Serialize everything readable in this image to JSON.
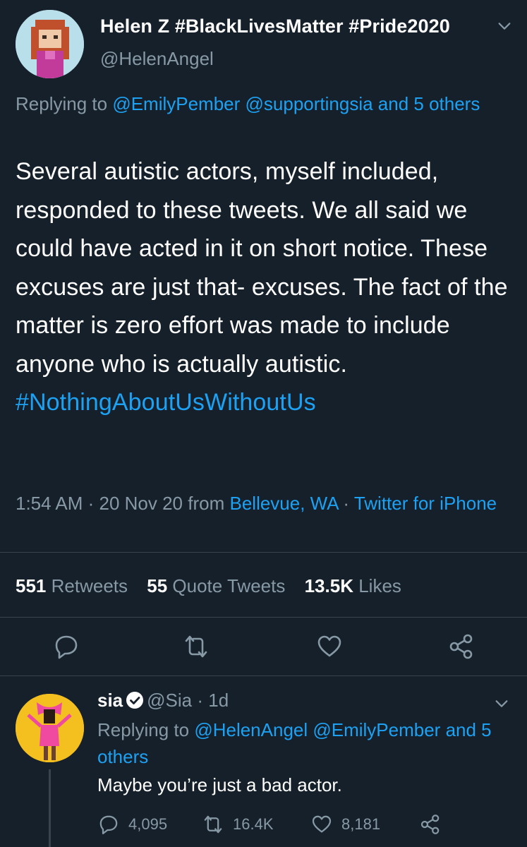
{
  "main": {
    "display_name": "Helen Z #BlackLivesMatter #Pride2020",
    "handle": "@HelenAngel",
    "replying_prefix": "Replying to",
    "replying_users": "@EmilyPember @supportingsia and 5 others",
    "text": "Several autistic actors, myself included, responded to these tweets. We all said we could have acted in it on short notice. These excuses are just that- excuses. The fact of the matter is zero effort was made to include anyone who is actually autistic.",
    "hashtag": "#NothingAboutUsWithoutUs",
    "time": "1:54 AM · 20 Nov 20 from",
    "location": "Bellevue, WA",
    "sep": "·",
    "source": "Twitter for iPhone",
    "stats": {
      "retweets_count": "551",
      "retweets_label": "Retweets",
      "quotes_count": "55",
      "quotes_label": "Quote Tweets",
      "likes_count": "13.5K",
      "likes_label": "Likes"
    }
  },
  "reply": {
    "name": "sia",
    "handle": "@Sia",
    "age": "· 1d",
    "replying_prefix": "Replying to",
    "replying_users": "@HelenAngel @EmilyPember and 5 others",
    "text": "Maybe you’re just a bad actor.",
    "reply_count": "4,095",
    "retweet_count": "16.4K",
    "like_count": "8,181"
  },
  "colors": {
    "background": "#15202b",
    "link": "#1da1f2",
    "muted": "#8899a6",
    "divider": "#38444d"
  }
}
